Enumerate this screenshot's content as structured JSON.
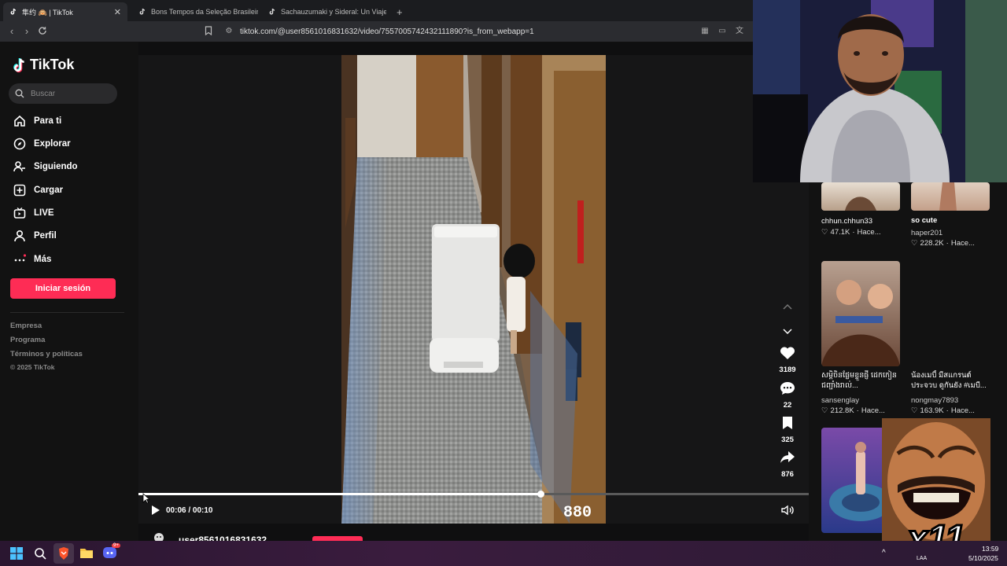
{
  "browser": {
    "tabs": [
      {
        "label": "隼约 🙉 | TikTok",
        "active": true
      },
      {
        "label": "Bons Tempos da Seleção Brasileira de",
        "active": false
      },
      {
        "label": "Sachauzumaki y Sideral: Un Viaje Cre",
        "active": false
      }
    ],
    "new_tab": "+",
    "url": "tiktok.com/@user8561016831632/video/7557005742432111890?is_from_webapp=1"
  },
  "sidebar": {
    "logo": "TikTok",
    "search_placeholder": "Buscar",
    "nav": [
      {
        "label": "Para ti",
        "icon": "home-icon"
      },
      {
        "label": "Explorar",
        "icon": "compass-icon"
      },
      {
        "label": "Siguiendo",
        "icon": "following-icon"
      },
      {
        "label": "Cargar",
        "icon": "upload-icon"
      },
      {
        "label": "LIVE",
        "icon": "live-icon"
      },
      {
        "label": "Perfil",
        "icon": "profile-icon"
      },
      {
        "label": "Más",
        "icon": "more-icon"
      }
    ],
    "login_label": "Iniciar sesión",
    "footer": [
      "Empresa",
      "Programa",
      "Términos y políticas"
    ],
    "copyright": "© 2025 TikTok"
  },
  "video": {
    "likes": "3189",
    "comments": "22",
    "saves": "325",
    "shares": "876",
    "time": "00:06 / 00:10",
    "progress": 0.6,
    "overlay_code": "880",
    "author_partial": "user8561016831632"
  },
  "related": [
    {
      "title": "",
      "author": "chhun.chhun33",
      "likes": "47.1K",
      "when": "Hace..."
    },
    {
      "title": "so cute",
      "author": "haper201",
      "likes": "228.2K",
      "when": "Hace..."
    },
    {
      "title": "សម្តិចិនផ្លែមខ្លួនផ្ញី ដេកកៀនជញ្ជាំងរាល់...",
      "author": "sansenglay",
      "likes": "212.8K",
      "when": "Hace..."
    },
    {
      "title": "น้องเมบี้ มีสแกรนต์ ประจวบ ดูกันยัง #เมบี...",
      "author": "nongmay7893",
      "likes": "163.9K",
      "when": "Hace..."
    }
  ],
  "meme_overlay": "x11",
  "taskbar": {
    "time": "13:59",
    "date": "5/10/2025",
    "lang": "LAA",
    "discord_badge": "9+"
  }
}
